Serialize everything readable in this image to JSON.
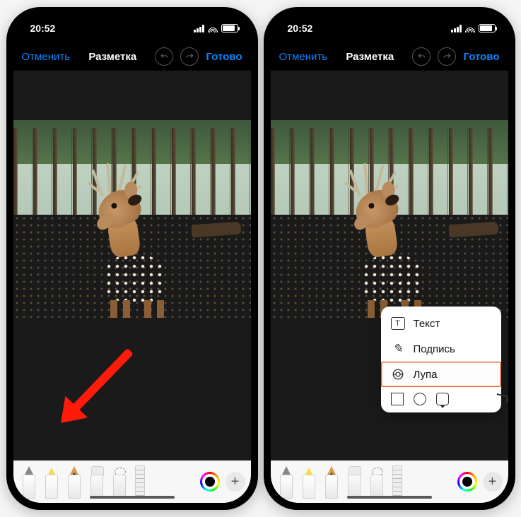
{
  "status": {
    "time": "20:52"
  },
  "nav": {
    "cancel": "Отменить",
    "title": "Разметка",
    "done": "Готово"
  },
  "popup": {
    "text": "Текст",
    "signature": "Подпись",
    "magnifier": "Лупа"
  },
  "tools": {
    "pen": "pen",
    "marker": "marker",
    "pencil": "pencil",
    "eraser": "eraser",
    "lasso": "lasso",
    "ruler": "ruler",
    "color": "color-picker",
    "plus": "+"
  },
  "shapes": {
    "square": "square",
    "circle": "circle",
    "speech": "speech-bubble",
    "arrow": "arrow"
  }
}
